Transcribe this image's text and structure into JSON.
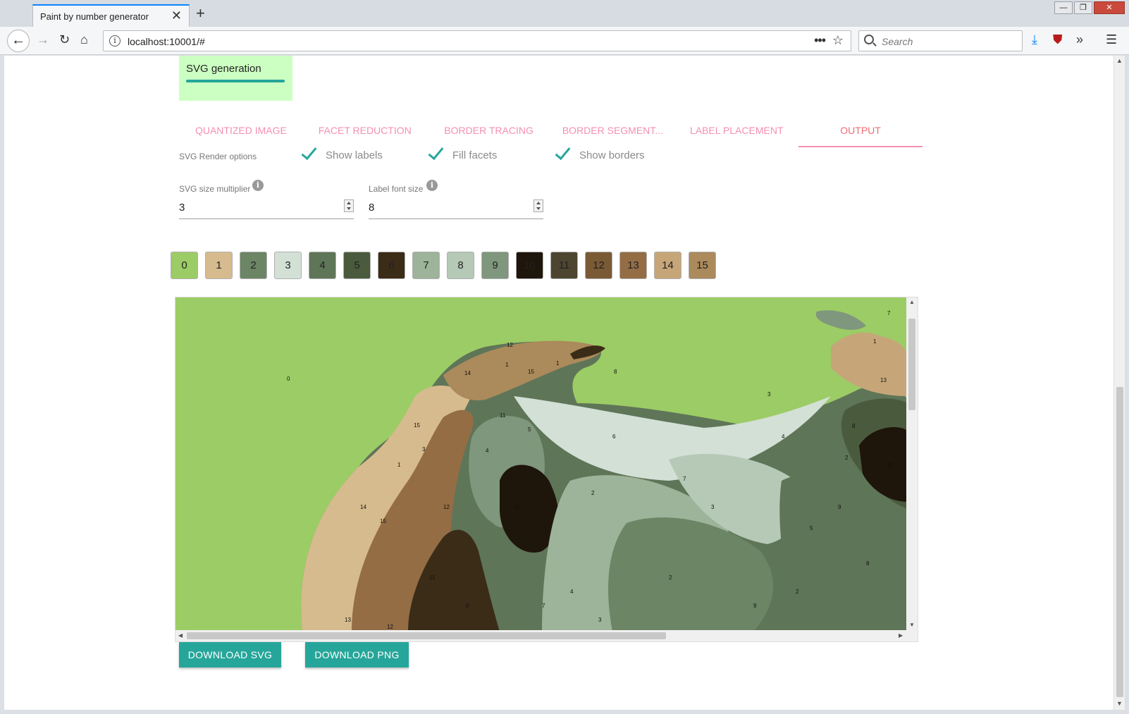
{
  "browser": {
    "tab_title": "Paint by number generator",
    "tab_close": "✕",
    "new_tab": "+",
    "url": "localhost:10001/#",
    "search_placeholder": "Search",
    "url_more": "•••"
  },
  "sidebar": {
    "step_label": "SVG generation"
  },
  "tabs": [
    {
      "label": "Quantized image"
    },
    {
      "label": "Facet reduction"
    },
    {
      "label": "Border tracing"
    },
    {
      "label": "Border segment..."
    },
    {
      "label": "Label placement"
    },
    {
      "label": "Output"
    }
  ],
  "render_options": {
    "label": "SVG Render options",
    "show_labels": "Show labels",
    "fill_facets": "Fill facets",
    "show_borders": "Show borders"
  },
  "fields": {
    "size_multiplier": {
      "label": "SVG size multiplier",
      "value": "3"
    },
    "label_font_size": {
      "label": "Label font size",
      "value": "8"
    }
  },
  "palette": [
    {
      "label": "0",
      "color": "#9ccc65"
    },
    {
      "label": "1",
      "color": "#d6bb8e"
    },
    {
      "label": "2",
      "color": "#6c8565"
    },
    {
      "label": "3",
      "color": "#d3e0d6"
    },
    {
      "label": "4",
      "color": "#5f7558"
    },
    {
      "label": "5",
      "color": "#4a5b3d"
    },
    {
      "label": "6",
      "color": "#3b2c17"
    },
    {
      "label": "7",
      "color": "#9db39a"
    },
    {
      "label": "8",
      "color": "#b5c9b6"
    },
    {
      "label": "9",
      "color": "#7f977c"
    },
    {
      "label": "10",
      "color": "#1e150b"
    },
    {
      "label": "11",
      "color": "#4d4530"
    },
    {
      "label": "12",
      "color": "#7a5a35"
    },
    {
      "label": "13",
      "color": "#946d45"
    },
    {
      "label": "14",
      "color": "#c6a679"
    },
    {
      "label": "15",
      "color": "#ab8a5b"
    }
  ],
  "preview_labels": [
    "0",
    "1",
    "2",
    "3",
    "4",
    "5",
    "6",
    "7",
    "8",
    "9",
    "10",
    "11",
    "12",
    "13",
    "14",
    "15"
  ],
  "buttons": {
    "download_svg": "Download SVG",
    "download_png": "Download PNG"
  }
}
